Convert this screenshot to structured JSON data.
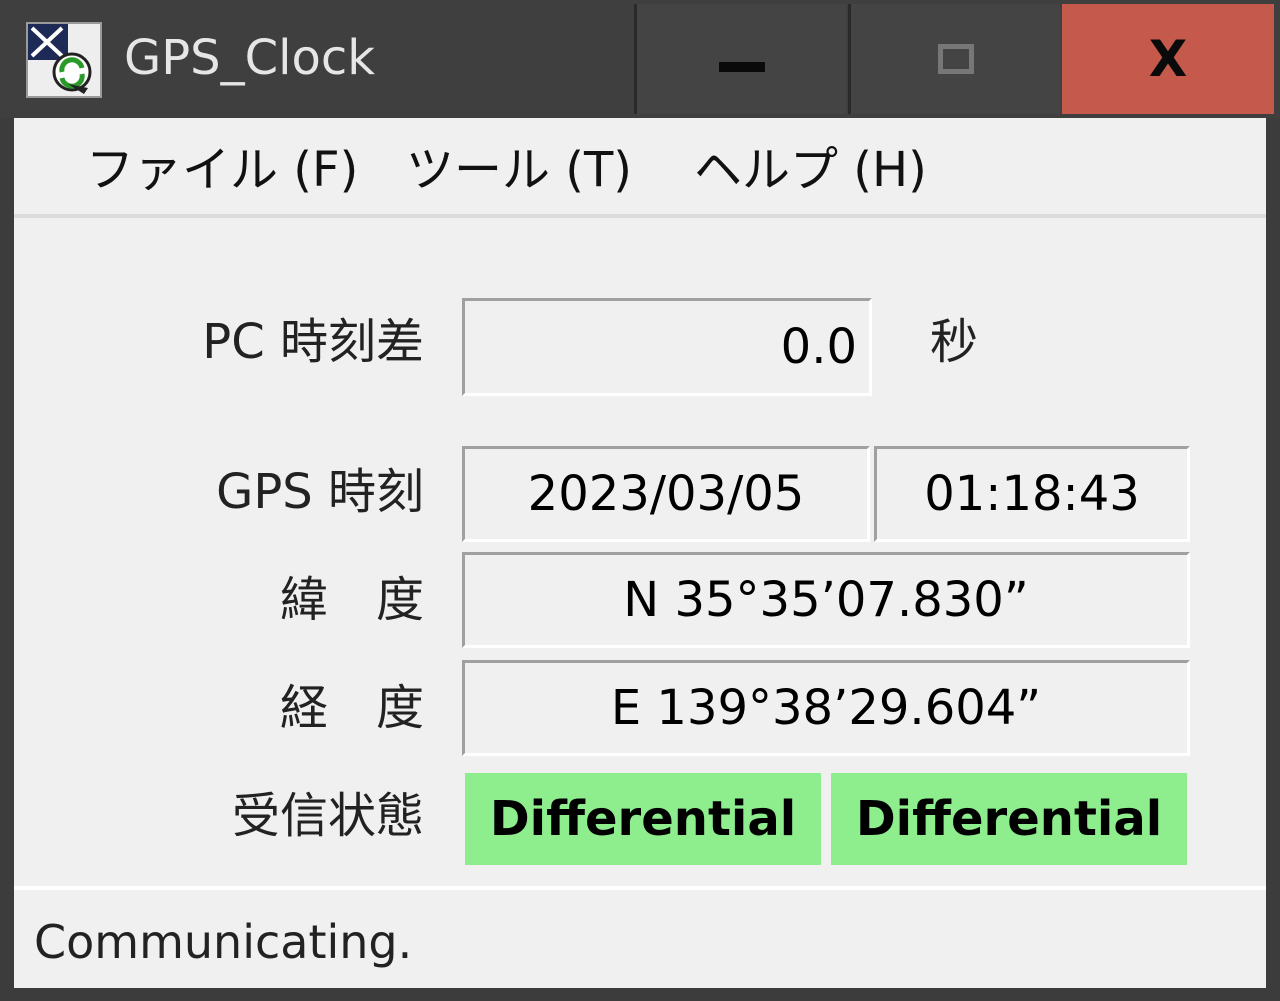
{
  "window": {
    "title": "GPS_Clock",
    "controls": {
      "minimize": "minimize-icon",
      "maximize": "maximize-icon",
      "close_label": "X"
    }
  },
  "menu": {
    "file": "ファイル (F)",
    "tools": "ツール (T)",
    "help": "ヘルプ (H)"
  },
  "fields": {
    "pc_offset": {
      "label": "PC 時刻差",
      "value": "0.0",
      "unit": "秒"
    },
    "gps_time": {
      "label": "GPS 時刻",
      "date": "2023/03/05",
      "time": "01:18:43"
    },
    "latitude": {
      "label": "緯　度",
      "value": "N  35°35’07.830”"
    },
    "longitude": {
      "label": "経　度",
      "value": "E 139°38’29.604”"
    },
    "reception": {
      "label": "受信状態",
      "status1": "Differential",
      "status2": "Differential"
    }
  },
  "status_bar": {
    "text": "Communicating."
  },
  "colors": {
    "titlebar": "#3f3f3f",
    "close_button": "#c4594c",
    "status_ok": "#8eee8e",
    "background": "#f0f0f0"
  }
}
